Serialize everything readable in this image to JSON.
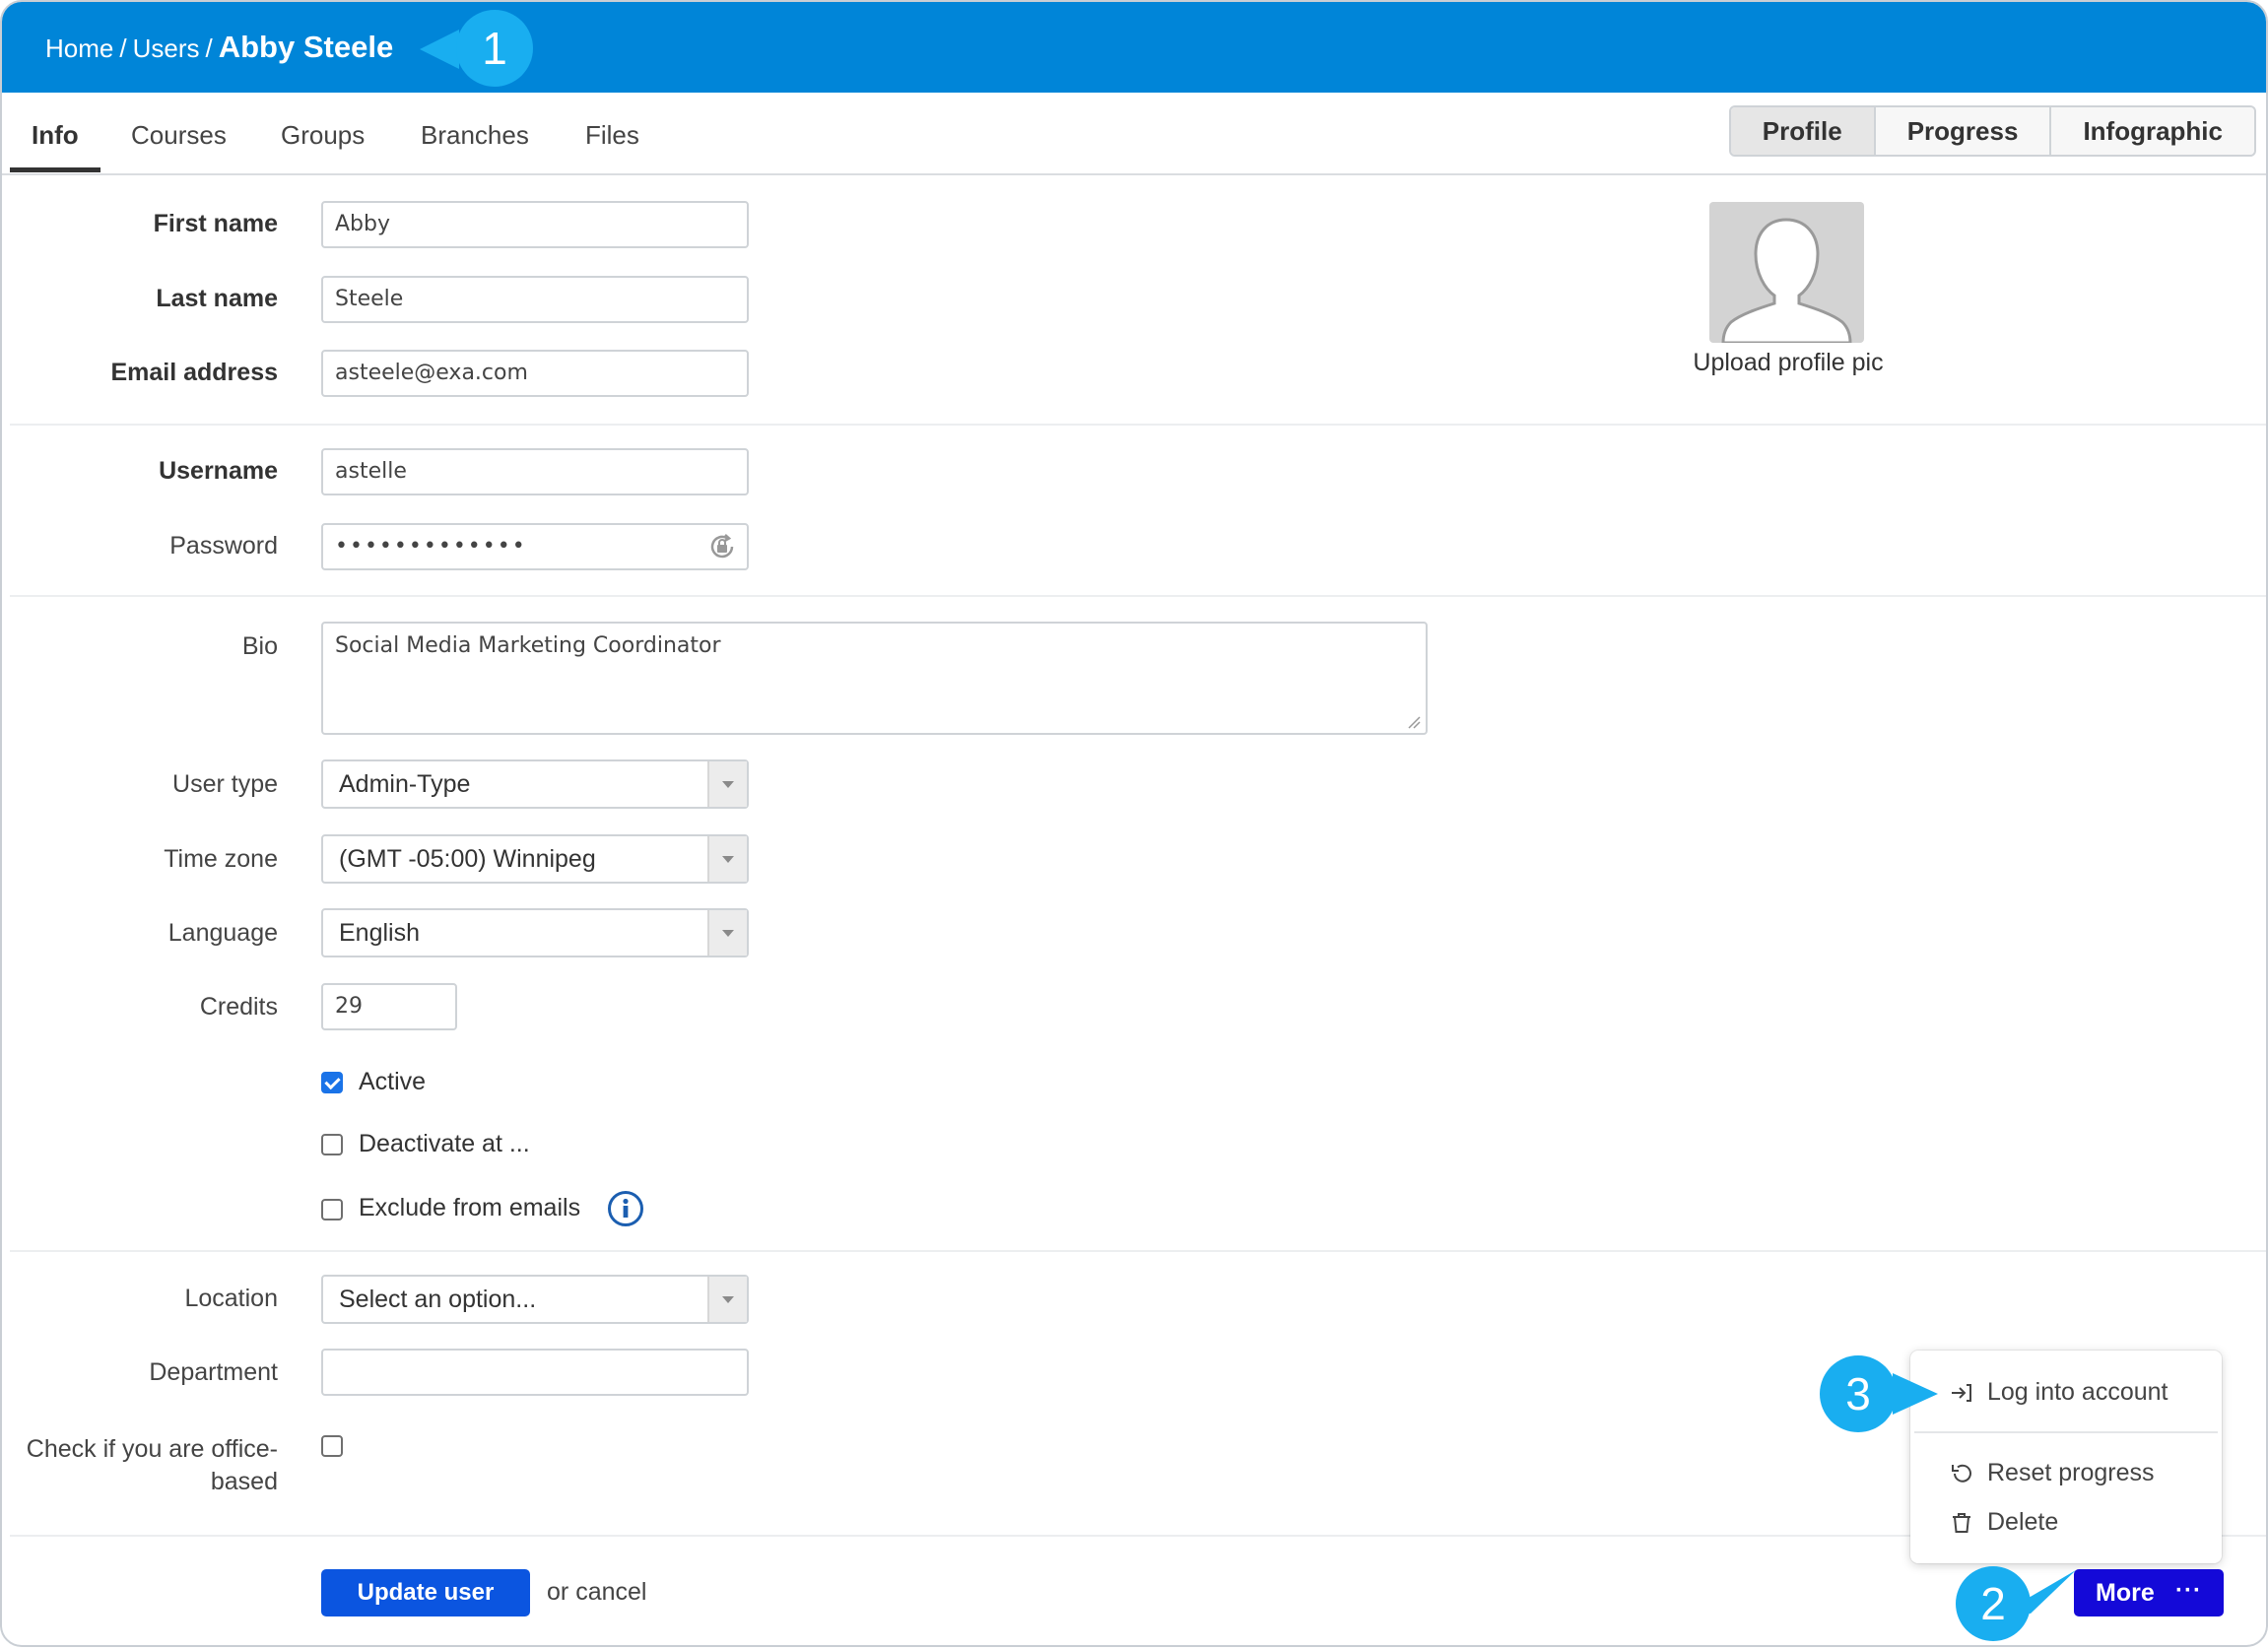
{
  "breadcrumb": {
    "home": "Home",
    "users": "Users",
    "current": "Abby Steele",
    "separator": "/"
  },
  "callouts": {
    "first": "1",
    "second": "2",
    "third": "3",
    "color": "#19aef0"
  },
  "tabs": [
    {
      "label": "Info",
      "active": true
    },
    {
      "label": "Courses"
    },
    {
      "label": "Groups"
    },
    {
      "label": "Branches"
    },
    {
      "label": "Files"
    }
  ],
  "view_switch": [
    {
      "label": "Profile",
      "selected": true
    },
    {
      "label": "Progress"
    },
    {
      "label": "Infographic"
    }
  ],
  "form": {
    "first_name": {
      "label": "First name",
      "value": "Abby"
    },
    "last_name": {
      "label": "Last name",
      "value": "Steele"
    },
    "email": {
      "label": "Email address",
      "value": "asteele@exa.com"
    },
    "username": {
      "label": "Username",
      "value": "astelle"
    },
    "password": {
      "label": "Password",
      "value": "•••••••••••••",
      "icon": "lock-refresh-icon"
    },
    "bio": {
      "label": "Bio",
      "value": "Social Media Marketing Coordinator"
    },
    "user_type": {
      "label": "User type",
      "value": "Admin-Type"
    },
    "time_zone": {
      "label": "Time zone",
      "value": "(GMT -05:00) Winnipeg"
    },
    "language": {
      "label": "Language",
      "value": "English"
    },
    "credits": {
      "label": "Credits",
      "value": "29"
    },
    "active": {
      "label": "Active",
      "checked": true
    },
    "deactivate": {
      "label": "Deactivate at ...",
      "checked": false
    },
    "exclude_emails": {
      "label": "Exclude from emails",
      "checked": false,
      "icon": "info-icon"
    },
    "location": {
      "label": "Location",
      "value": "Select an option..."
    },
    "department": {
      "label": "Department",
      "value": ""
    },
    "office_based": {
      "label_line1": "Check if you are office-",
      "label_line2": "based",
      "checked": false
    }
  },
  "profile_pic": {
    "label": "Upload profile pic"
  },
  "actions": {
    "update": "Update user",
    "or_text": "or",
    "cancel": "cancel",
    "more": "More",
    "more_dots": "···"
  },
  "menu": {
    "log_into_account": "Log into account",
    "reset_progress": "Reset progress",
    "delete": "Delete"
  },
  "colors": {
    "header": "#0085d8",
    "primary_button": "#0b55e0",
    "more_button": "#1409d8",
    "checkbox": "#1a73e8"
  }
}
